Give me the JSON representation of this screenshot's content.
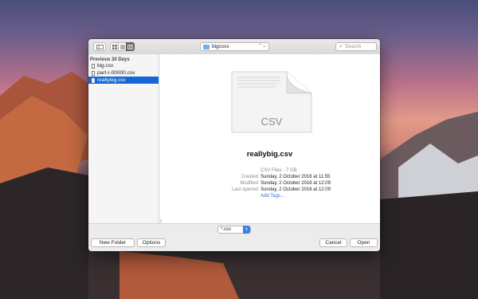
{
  "toolbar": {
    "sidebar_toggle_icon": "sidebar-icon",
    "view_modes": [
      "icon-view-icon",
      "list-view-icon",
      "column-view-icon"
    ],
    "location": "bigcsvs",
    "search_placeholder": "Search"
  },
  "sidebar": {
    "header": "Previous 30 Days",
    "items": [
      {
        "label": "big.csv",
        "selected": false
      },
      {
        "label": "part-r-00000.csv",
        "selected": false
      },
      {
        "label": "reallybig.csv",
        "selected": true
      }
    ]
  },
  "preview": {
    "thumb_label": "CSV",
    "file_name": "reallybig.csv",
    "kind": "CSV Files - 7 GB",
    "labels": {
      "created": "Created",
      "modified": "Modified",
      "last_opened": "Last opened"
    },
    "created": "Sunday, 2 October 2016 at 11:55",
    "modified": "Sunday, 2 October 2016 at 12:09",
    "last_opened": "Sunday, 2 October 2016 at 12:09",
    "add_tags": "Add Tags..."
  },
  "filter": {
    "value": "*.csv"
  },
  "buttons": {
    "new_folder": "New Folder",
    "options": "Options",
    "cancel": "Cancel",
    "open": "Open"
  },
  "colors": {
    "selection": "#1467d6",
    "link": "#2a6fd6",
    "filter_accent": "#3a7ee8"
  }
}
